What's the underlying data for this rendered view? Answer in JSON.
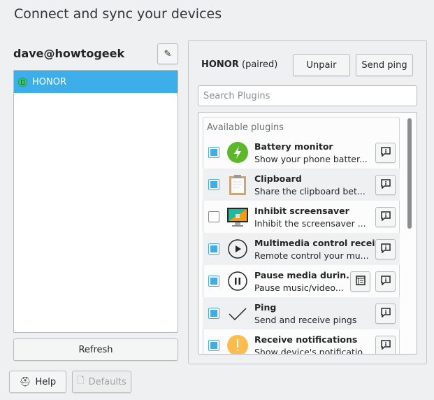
{
  "window": {
    "title": "Connect and sync your devices"
  },
  "account": {
    "name": "dave@howtogeek",
    "edit_icon": "pencil-icon"
  },
  "devices": [
    {
      "name": "HONOR",
      "status_icon": "device-connected-icon"
    }
  ],
  "refresh_label": "Refresh",
  "device": {
    "name": "HONOR",
    "status": "(paired)",
    "unpair_label": "Unpair",
    "ping_label": "Send ping"
  },
  "search": {
    "placeholder": "Search Plugins"
  },
  "plugins": {
    "header": "Available plugins",
    "items": [
      {
        "name": "Battery monitor",
        "desc": "Show your phone batter...",
        "enabled": true,
        "icon": "battery-bolt-icon"
      },
      {
        "name": "Clipboard",
        "desc": "Share the clipboard bet...",
        "enabled": true,
        "icon": "clipboard-icon"
      },
      {
        "name": "Inhibit screensaver",
        "desc": "Inhibit the screensaver ...",
        "enabled": false,
        "icon": "screensaver-icon"
      },
      {
        "name": "Multimedia control recei...",
        "desc": "Remote control your mu...",
        "enabled": true,
        "icon": "play-icon"
      },
      {
        "name": "Pause media durin...",
        "desc": "Pause music/video...",
        "enabled": true,
        "icon": "pause-icon",
        "configurable": true
      },
      {
        "name": "Ping",
        "desc": "Send and receive pings",
        "enabled": true,
        "icon": "checkmark-icon"
      },
      {
        "name": "Receive notifications",
        "desc": "Show device's notificatio",
        "enabled": true,
        "icon": "warning-icon"
      }
    ]
  },
  "footer": {
    "help_label": "Help",
    "defaults_label": "Defaults"
  },
  "colors": {
    "accent": "#3daee9"
  }
}
